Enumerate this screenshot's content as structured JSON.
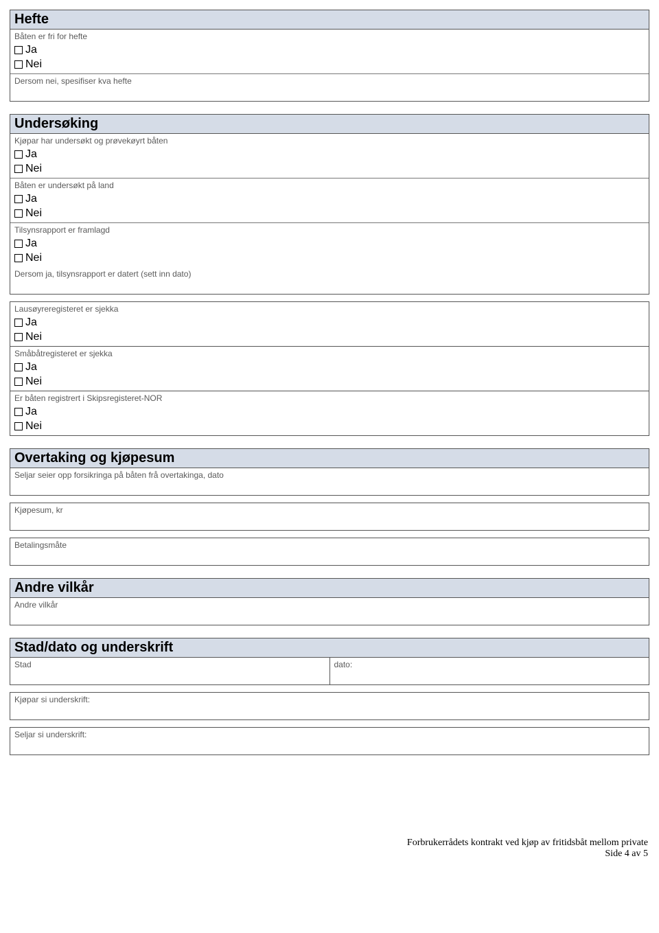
{
  "opts": {
    "ja": "Ja",
    "nei": "Nei"
  },
  "hefte": {
    "title": "Hefte",
    "fri_label": "Båten er fri for hefte",
    "spes_label": "Dersom nei, spesifiser kva hefte"
  },
  "undersoking": {
    "title": "Undersøking",
    "q1": "Kjøpar har undersøkt og prøvekøyrt båten",
    "q2": "Båten er undersøkt på land",
    "q3": "Tilsynsrapport er framlagd",
    "q3_date": "Dersom ja, tilsynsrapport er datert (sett inn dato)",
    "q4": "Lausøyreregisteret er sjekka",
    "q5": "Småbåtregisteret er sjekka",
    "q6": "Er båten registrert i Skipsregisteret-NOR"
  },
  "overtaking": {
    "title": "Overtaking og kjøpesum",
    "forsikring": "Seljar seier opp forsikringa på båten frå overtakinga, dato",
    "kjopesum": "Kjøpesum, kr",
    "betaling": "Betalingsmåte"
  },
  "andre": {
    "title": "Andre vilkår",
    "label": "Andre vilkår"
  },
  "signatur": {
    "title": "Stad/dato og underskrift",
    "stad": "Stad",
    "dato": "dato:",
    "kjopar": "Kjøpar si underskrift:",
    "seljar": "Seljar si underskrift:"
  },
  "footer": {
    "line1": "Forbrukerrådets kontrakt ved kjøp av fritidsbåt mellom private",
    "line2": "Side 4 av 5"
  }
}
